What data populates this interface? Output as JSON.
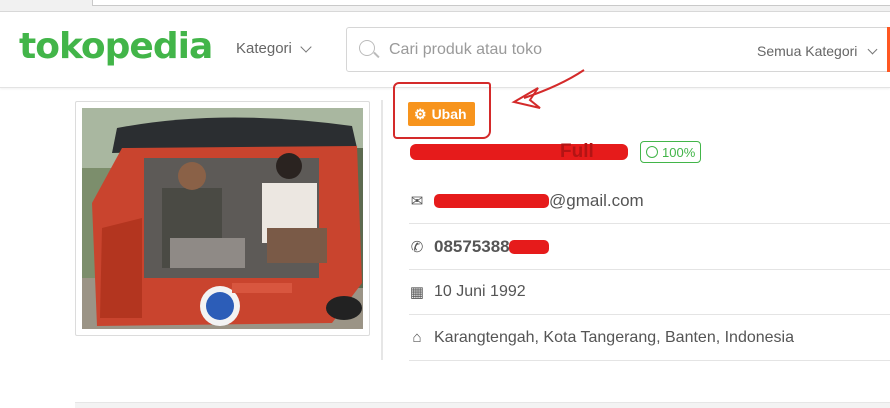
{
  "header": {
    "logo_text": "tokopedia",
    "kategori_label": "Kategori",
    "search_placeholder": "Cari produk atau toko",
    "search_category": "Semua Kategori"
  },
  "profile": {
    "edit_label": "Ubah",
    "name_suffix": "Full",
    "reputation": "100%",
    "email_domain": "@gmail.com",
    "phone_visible": "08575388",
    "birth_date": "10 Juni 1992",
    "address": "Karangtengah, Kota Tangerang, Banten, Indonesia"
  },
  "icons": [
    "search-icon",
    "chevron-down-icon",
    "gear-icon",
    "smile-icon",
    "envelope-icon",
    "phone-icon",
    "calendar-icon",
    "home-icon"
  ],
  "colors": {
    "brand_green": "#42b549",
    "edit_orange": "#f7941d",
    "annotation_red": "#d42a2a",
    "accent_orange": "#ff5722"
  }
}
